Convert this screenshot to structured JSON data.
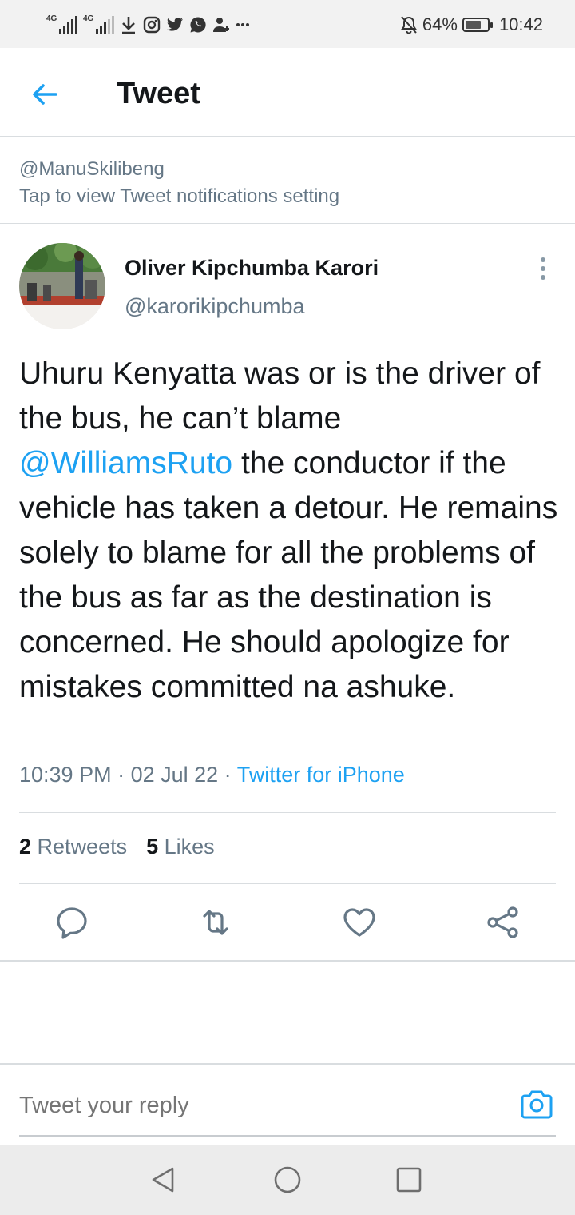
{
  "status_bar": {
    "network1": "4G",
    "network2": "4G",
    "battery": "64%",
    "time": "10:42",
    "icons": [
      "signal-icon",
      "signal-icon",
      "download-icon",
      "instagram-icon",
      "twitter-icon",
      "whatsapp-icon",
      "user-add-icon",
      "more-dots-icon",
      "mute-bell-icon",
      "battery-icon"
    ]
  },
  "header": {
    "title": "Tweet",
    "back_icon": "arrow-left-icon"
  },
  "notification_banner": {
    "handle": "@ManuSkilibeng",
    "message": "Tap to view Tweet notifications setting"
  },
  "tweet": {
    "author": {
      "name": "Oliver Kipchumba Karori",
      "handle": "@karorikipchumba"
    },
    "text": {
      "part1": "Uhuru Kenyatta was or is the driver of the bus, he can’t blame ",
      "mention": "@WilliamsRuto",
      "part2": " the conductor if the vehicle has taken a detour. He remains solely to blame for all the problems of the bus as far as the destination is concerned. He should apologize for mistakes committed na ashuke."
    },
    "time": "10:39 PM",
    "date": "02 Jul 22",
    "source": "Twitter for iPhone",
    "retweets_count": "2",
    "retweets_label": "Retweets",
    "likes_count": "5",
    "likes_label": "Likes"
  },
  "actions": {
    "reply_icon": "comment-icon",
    "retweet_icon": "retweet-icon",
    "like_icon": "heart-icon",
    "share_icon": "share-icon"
  },
  "reply_bar": {
    "placeholder": "Tweet your reply"
  },
  "colors": {
    "accent": "#1da1f2",
    "text": "#14171a",
    "muted": "#657786"
  }
}
